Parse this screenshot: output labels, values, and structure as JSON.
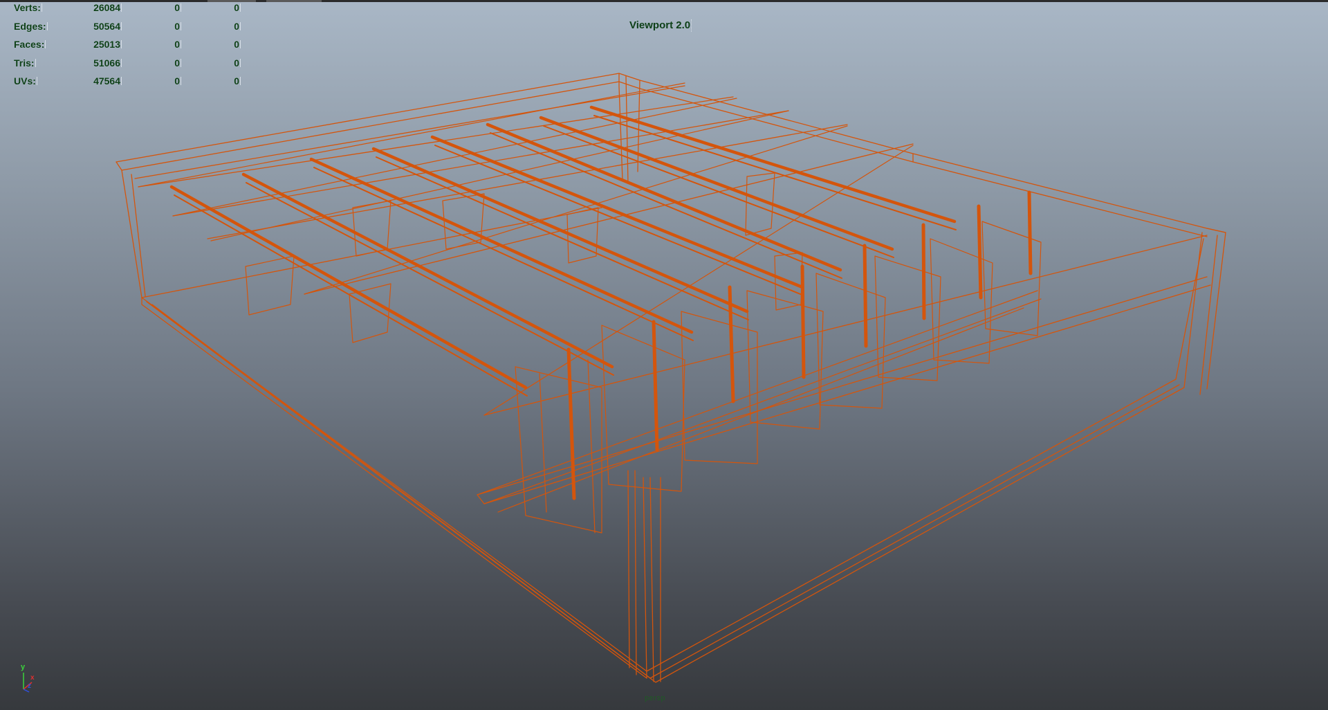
{
  "viewport": {
    "title": "Viewport 2.0",
    "camera": "persp",
    "wire_color": "#d4550c",
    "background_top": "#a9b7c6",
    "background_bottom": "#36393d"
  },
  "hud": {
    "rows": [
      {
        "label": "Verts:",
        "v1": "26084",
        "v2": "0",
        "v3": "0"
      },
      {
        "label": "Edges:",
        "v1": "50564",
        "v2": "0",
        "v3": "0"
      },
      {
        "label": "Faces:",
        "v1": "25013",
        "v2": "0",
        "v3": "0"
      },
      {
        "label": "Tris:",
        "v1": "51066",
        "v2": "0",
        "v3": "0"
      },
      {
        "label": "UVs:",
        "v1": "47564",
        "v2": "0",
        "v3": "0"
      }
    ],
    "text_color": "#0c3f16"
  },
  "axis_gizmo": {
    "y": "y",
    "x": "x",
    "z": "z"
  }
}
